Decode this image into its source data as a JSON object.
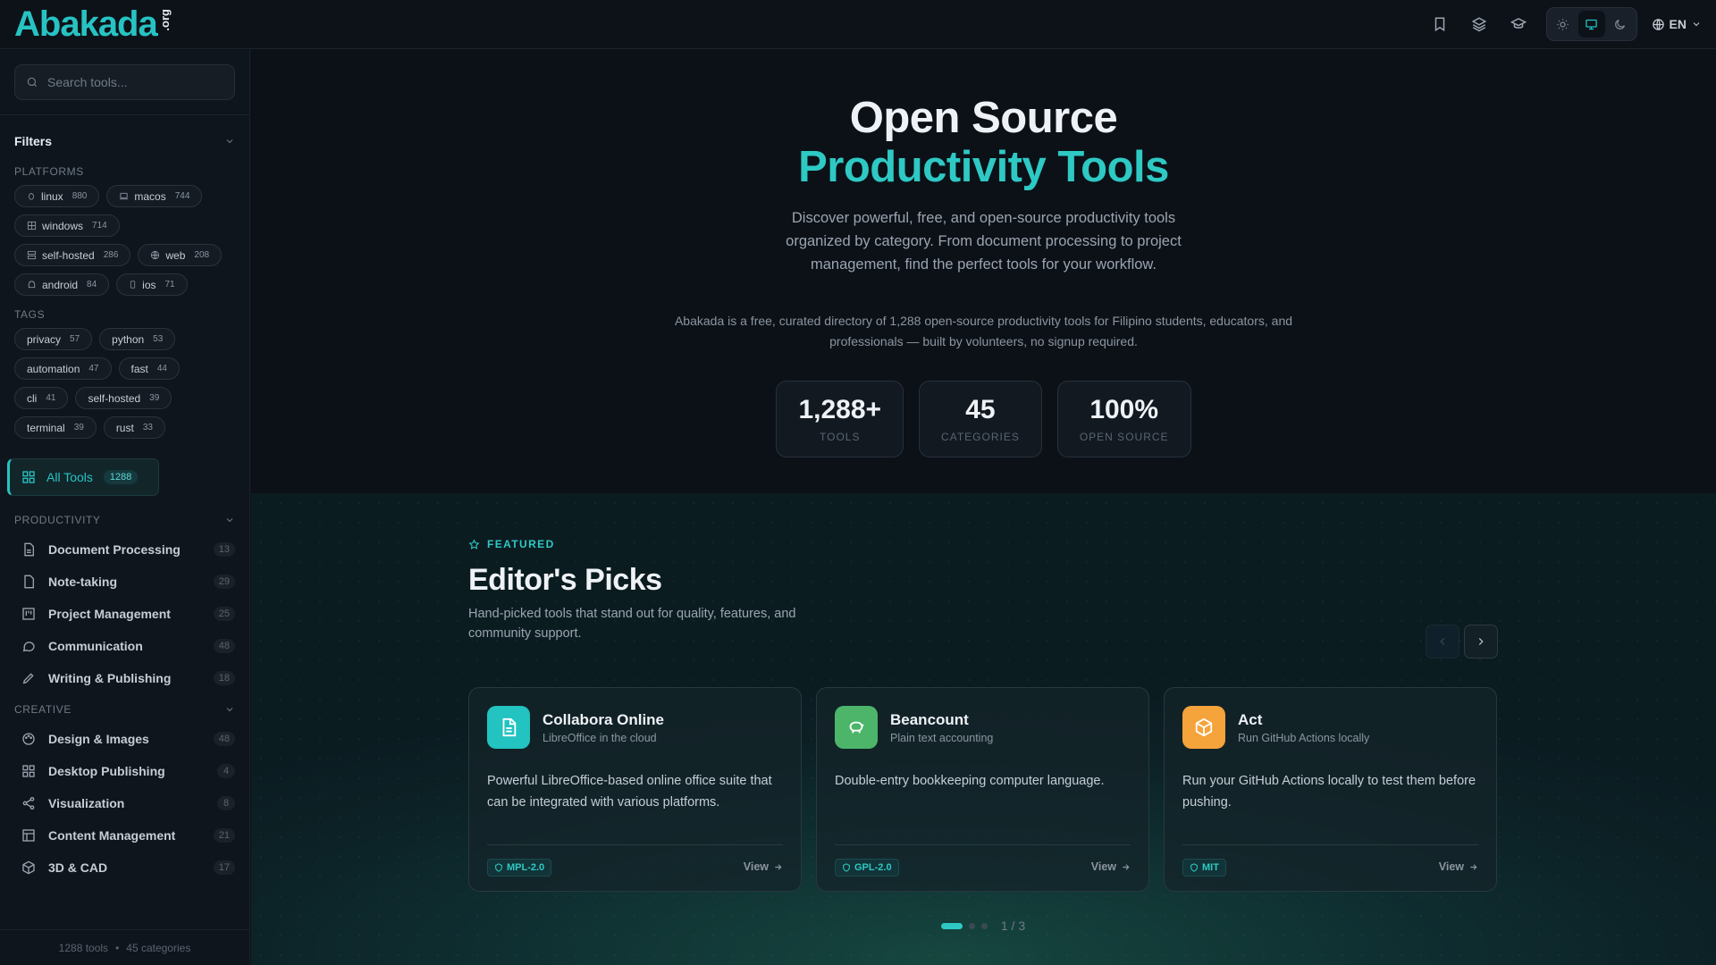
{
  "brand": {
    "name": "Abakada",
    "suffix": ".org"
  },
  "header": {
    "icons": [
      "bookmark-icon",
      "layers-icon",
      "graduation-cap-icon"
    ],
    "theme_options": [
      "sun-icon",
      "monitor-icon",
      "moon-icon"
    ],
    "theme_active": "monitor-icon",
    "language": "EN"
  },
  "sidebar": {
    "search_placeholder": "Search tools...",
    "filters_label": "Filters",
    "platforms_label": "PLATFORMS",
    "platforms": [
      {
        "label": "linux",
        "count": "880",
        "icon": "penguin-icon"
      },
      {
        "label": "macos",
        "count": "744",
        "icon": "laptop-icon"
      },
      {
        "label": "windows",
        "count": "714",
        "icon": "windows-icon"
      },
      {
        "label": "self-hosted",
        "count": "286",
        "icon": "server-icon"
      },
      {
        "label": "web",
        "count": "208",
        "icon": "globe-icon"
      },
      {
        "label": "android",
        "count": "84",
        "icon": "android-icon"
      },
      {
        "label": "ios",
        "count": "71",
        "icon": "phone-icon"
      }
    ],
    "tags_label": "TAGS",
    "tags": [
      {
        "label": "privacy",
        "count": "57"
      },
      {
        "label": "python",
        "count": "53"
      },
      {
        "label": "automation",
        "count": "47"
      },
      {
        "label": "fast",
        "count": "44"
      },
      {
        "label": "cli",
        "count": "41"
      },
      {
        "label": "self-hosted",
        "count": "39"
      },
      {
        "label": "terminal",
        "count": "39"
      },
      {
        "label": "rust",
        "count": "33"
      }
    ],
    "all_tools": {
      "label": "All Tools",
      "count": "1288"
    },
    "groups": [
      {
        "label": "PRODUCTIVITY",
        "items": [
          {
            "label": "Document Processing",
            "count": "13",
            "icon": "document-icon"
          },
          {
            "label": "Note-taking",
            "count": "29",
            "icon": "note-icon"
          },
          {
            "label": "Project Management",
            "count": "25",
            "icon": "kanban-icon"
          },
          {
            "label": "Communication",
            "count": "48",
            "icon": "chat-icon"
          },
          {
            "label": "Writing & Publishing",
            "count": "18",
            "icon": "pen-icon"
          }
        ]
      },
      {
        "label": "CREATIVE",
        "items": [
          {
            "label": "Design & Images",
            "count": "48",
            "icon": "palette-icon"
          },
          {
            "label": "Desktop Publishing",
            "count": "4",
            "icon": "layout-icon"
          },
          {
            "label": "Visualization",
            "count": "8",
            "icon": "share-icon"
          },
          {
            "label": "Content Management",
            "count": "21",
            "icon": "table-icon"
          },
          {
            "label": "3D & CAD",
            "count": "17",
            "icon": "cube-icon"
          }
        ]
      }
    ],
    "footer_tools": "1288 tools",
    "footer_sep": "•",
    "footer_categories": "45 categories"
  },
  "hero": {
    "title_line1": "Open Source",
    "title_line2": "Productivity Tools",
    "description": "Discover powerful, free, and open-source productivity tools organized by category. From document processing to project management, find the perfect tools for your workflow.",
    "note": "Abakada is a free, curated directory of 1,288 open-source productivity tools for Filipino students, educators, and professionals — built by volunteers, no signup required.",
    "stats": [
      {
        "value": "1,288+",
        "label": "TOOLS"
      },
      {
        "value": "45",
        "label": "CATEGORIES"
      },
      {
        "value": "100%",
        "label": "OPEN SOURCE"
      }
    ]
  },
  "featured": {
    "tag": "FEATURED",
    "title": "Editor's Picks",
    "description": "Hand-picked tools that stand out for quality, features, and community support.",
    "cards": [
      {
        "name": "Collabora Online",
        "subtitle": "LibreOffice in the cloud",
        "description": "Powerful LibreOffice-based online office suite that can be integrated with various platforms.",
        "license": "MPL-2.0",
        "view_label": "View",
        "icon": "file-text-icon",
        "color": "#22c3c0"
      },
      {
        "name": "Beancount",
        "subtitle": "Plain text accounting",
        "description": "Double-entry bookkeeping computer language.",
        "license": "GPL-2.0",
        "view_label": "View",
        "icon": "piggy-bank-icon",
        "color": "#4cb56a"
      },
      {
        "name": "Act",
        "subtitle": "Run GitHub Actions locally",
        "description": "Run your GitHub Actions locally to test them before pushing.",
        "license": "MIT",
        "view_label": "View",
        "icon": "package-icon",
        "color": "#f5a33b"
      }
    ],
    "pager": {
      "current": 1,
      "total": 3,
      "text": "1 / 3"
    }
  }
}
